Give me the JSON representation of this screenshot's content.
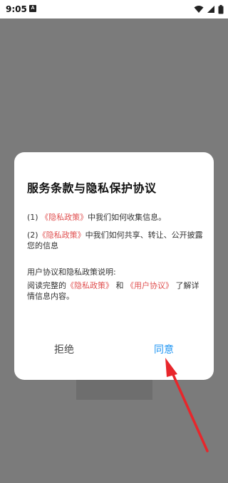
{
  "status_bar": {
    "time": "9:05",
    "notification_badge": "A",
    "icons": [
      "wifi-icon",
      "cellular-signal-icon",
      "battery-icon"
    ]
  },
  "dialog": {
    "title": "服务条款与隐私保护协议",
    "item1_prefix": "(1)",
    "item1_link": "《隐私政策》",
    "item1_text": "中我们如何收集信息。",
    "item2_prefix": "(2)",
    "item2_link": "《隐私政策》",
    "item2_text": "中我们如何共享、转让、公开披露您的信息",
    "explain_heading": "用户协议和隐私政策说明:",
    "explain_prefix": "阅读完整的",
    "explain_link1": "《隐私政策》",
    "explain_and": "和",
    "explain_link2": "《用户协议》",
    "explain_suffix": "了解详情信息内容。",
    "refuse_label": "拒绝",
    "agree_label": "同意"
  },
  "colors": {
    "overlay": "#7b7b7b",
    "link": "#e05050",
    "agree": "#2196f3",
    "arrow": "#e8262b"
  }
}
